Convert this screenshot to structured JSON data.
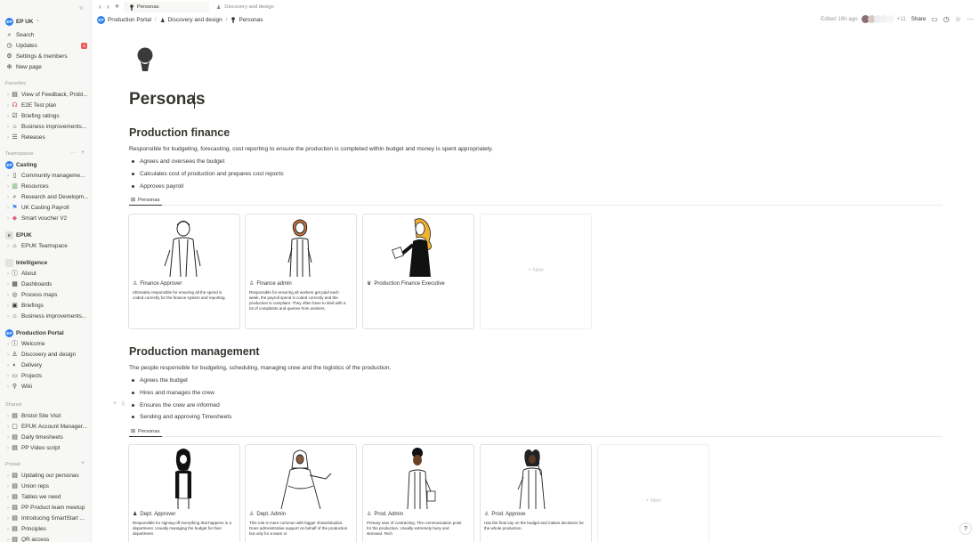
{
  "sidebar": {
    "workspace": {
      "badge": "EP",
      "name": "EP UK"
    },
    "top_items": [
      {
        "icon": "search-icon",
        "label": "Search"
      },
      {
        "icon": "updates-icon",
        "label": "Updates",
        "badge": "9"
      },
      {
        "icon": "gear-icon",
        "label": "Settings & members"
      },
      {
        "icon": "plus-icon",
        "label": "New page"
      }
    ],
    "favorites_heading": "Favorites",
    "favorites": [
      {
        "icon": "page-icon",
        "label": "View of Feedback, Probl..."
      },
      {
        "icon": "test-plan-icon",
        "label": "E2E Test plan"
      },
      {
        "icon": "checkbox-icon",
        "label": "Briefing ratings"
      },
      {
        "icon": "building-icon",
        "label": "Business improvements..."
      },
      {
        "icon": "list-icon",
        "label": "Releases"
      }
    ],
    "teamspaces_heading": "Teamspaces",
    "teamspaces": [
      {
        "type": "space",
        "badge": "EP",
        "label": "Casting"
      },
      {
        "icon": "doc-icon",
        "label": "Community manageme..."
      },
      {
        "icon": "books-icon",
        "label": "Resources"
      },
      {
        "icon": "magnifier-icon",
        "label": "Research and Developm..."
      },
      {
        "icon": "flag-icon",
        "label": "UK Casting Payroll"
      },
      {
        "icon": "ticket-icon",
        "label": "Smart voucher V2"
      },
      {
        "type": "space",
        "badge": "E",
        "label": "EPUK"
      },
      {
        "icon": "building-icon",
        "label": "EPUK Teamspace"
      },
      {
        "type": "space",
        "badge": "",
        "label": "Intelligence"
      },
      {
        "icon": "info-icon",
        "label": "About"
      },
      {
        "icon": "dashboard-icon",
        "label": "Dashboards"
      },
      {
        "icon": "process-icon",
        "label": "Process maps"
      },
      {
        "icon": "briefing-icon",
        "label": "Briefings"
      },
      {
        "icon": "building-icon",
        "label": "Business improvements..."
      },
      {
        "type": "space",
        "badge": "EP",
        "label": "Production Portal"
      },
      {
        "icon": "info-icon",
        "label": "Welcome"
      },
      {
        "icon": "person-icon",
        "label": "Discovery and design"
      },
      {
        "icon": "delivery-icon",
        "label": "Delivery"
      },
      {
        "icon": "projects-icon",
        "label": "Projects"
      },
      {
        "icon": "wiki-icon",
        "label": "Wiki"
      }
    ],
    "shared_heading": "Shared",
    "shared": [
      {
        "icon": "page-icon",
        "label": "Bristol Site Visit"
      },
      {
        "icon": "computer-icon",
        "label": "EPUK Account Manager..."
      },
      {
        "icon": "page-icon",
        "label": "Daily timesheets"
      },
      {
        "icon": "page-icon",
        "label": "PP Video script"
      }
    ],
    "private_heading": "Private",
    "private": [
      {
        "icon": "page-icon",
        "label": "Updating our personas"
      },
      {
        "icon": "page-icon",
        "label": "Union reps"
      },
      {
        "icon": "page-icon",
        "label": "Tables we need"
      },
      {
        "icon": "page-icon",
        "label": "PP Product team meetup"
      },
      {
        "icon": "page-icon",
        "label": "Introducing SmartStart ..."
      },
      {
        "icon": "page-icon",
        "label": "Principles"
      },
      {
        "icon": "page-icon",
        "label": "QR access"
      }
    ]
  },
  "tabs": [
    {
      "label": "Personas",
      "active": true
    },
    {
      "label": "Discovery and design",
      "active": false
    }
  ],
  "breadcrumb": [
    {
      "badge": "EP",
      "label": "Production Portal"
    },
    {
      "label": "Discovery and design"
    },
    {
      "label": "Personas"
    }
  ],
  "topbar": {
    "edited": "Edited 19h ago",
    "extra_count": "+11",
    "share": "Share"
  },
  "page": {
    "title": "Personas",
    "sections": [
      {
        "heading": "Production finance",
        "description": "Responsible for budgeting, forecasting, cost reporting to ensure the production is completed within budget and money is spent appropriately.",
        "bullets": [
          "Agrees and oversees the budget",
          "Calculates cost of production and prepares cost reports",
          "Approves payroll"
        ],
        "view_tab": "Personas",
        "cards": [
          {
            "title": "Finance Approver",
            "description": "Ultimately responsible for ensuring all the spend is coded correctly for the finance system and reporting."
          },
          {
            "title": "Finance admin",
            "description": "Responsible for ensuring all workers get paid each week, the payroll spend is coded correctly and the production is compliant. They often have to deal with a lot of complaints and queries from workers."
          },
          {
            "title": "Production Finance Executive",
            "description": ""
          }
        ],
        "new_label": "+ New"
      },
      {
        "heading": "Production management",
        "description": "The people responsible for budgeting, scheduling, managing crew and the logistics of the production.",
        "bullets": [
          "Agrees the budget",
          "Hires and manages the crew",
          "Ensures the crew are informed",
          "Sending and approving Timesheets"
        ],
        "view_tab": "Personas",
        "cards": [
          {
            "title": "Dept. Approver",
            "description": "Responsible for signing-off everything that happens in a department. Usually managing the budget for their department."
          },
          {
            "title": "Dept. Admin",
            "description": "This role is more common with bigger shows/studios. Does administrative support on behalf of the production but only for a team or"
          },
          {
            "title": "Prod. Admin",
            "description": "Primary user of contracting. The communication point for the production. Usually extremely busy and stressed. Tech"
          },
          {
            "title": "Prod. Approve",
            "description": "Has the final say on the budget and makes decisions for the whole production."
          }
        ],
        "new_label": "+ New"
      }
    ]
  },
  "help": "?"
}
